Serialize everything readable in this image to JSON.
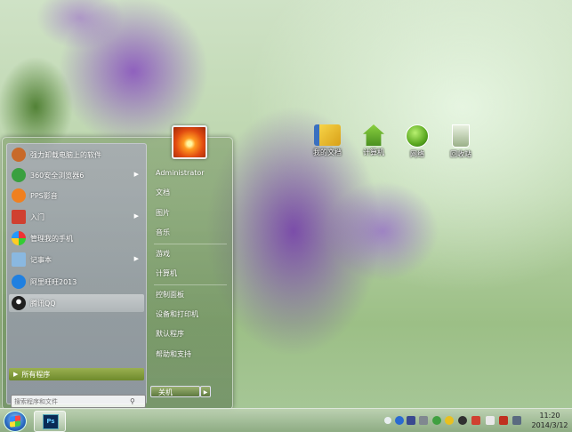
{
  "desktop": {
    "icons": [
      {
        "label": "我的文档",
        "icon": "documents-folder-icon",
        "color": "#f0c020"
      },
      {
        "label": "计算机",
        "icon": "computer-house-icon",
        "color": "#6ab030"
      },
      {
        "label": "网络",
        "icon": "network-globe-icon",
        "color": "#5aa820"
      },
      {
        "label": "回收站",
        "icon": "recycle-bin-icon",
        "color": "#8ab070"
      }
    ]
  },
  "start_menu": {
    "programs": [
      {
        "label": "强力卸载电脑上的软件",
        "icon": "uninstall-icon",
        "color": "#c86a2a",
        "arrow": ""
      },
      {
        "label": "360安全浏览器6",
        "icon": "browser-360-icon",
        "color": "#3aa040",
        "arrow": "▶"
      },
      {
        "label": "PPS影音",
        "icon": "pps-icon",
        "color": "#f08020",
        "arrow": ""
      },
      {
        "label": "入门",
        "icon": "getting-started-icon",
        "color": "#d04030",
        "arrow": "▶"
      },
      {
        "label": "管理我的手机",
        "icon": "phone-manager-icon",
        "color": "#30a0d0",
        "arrow": ""
      },
      {
        "label": "记事本",
        "icon": "notepad-icon",
        "color": "#8ab8e0",
        "arrow": "▶"
      },
      {
        "label": "阿里旺旺2013",
        "icon": "aliwangwang-icon",
        "color": "#2080e0",
        "arrow": ""
      },
      {
        "label": "腾讯QQ",
        "icon": "qq-icon",
        "color": "#202020",
        "arrow": ""
      }
    ],
    "all_programs": "所有程序",
    "search_placeholder": "搜索程序和文件",
    "user": "Administrator",
    "right_items": [
      "文档",
      "图片",
      "音乐",
      "游戏",
      "计算机",
      "控制面板",
      "设备和打印机",
      "默认程序",
      "帮助和支持"
    ],
    "shutdown": "关机"
  },
  "taskbar": {
    "app": "Ps",
    "time": "11:20",
    "date": "2014/3/12"
  }
}
